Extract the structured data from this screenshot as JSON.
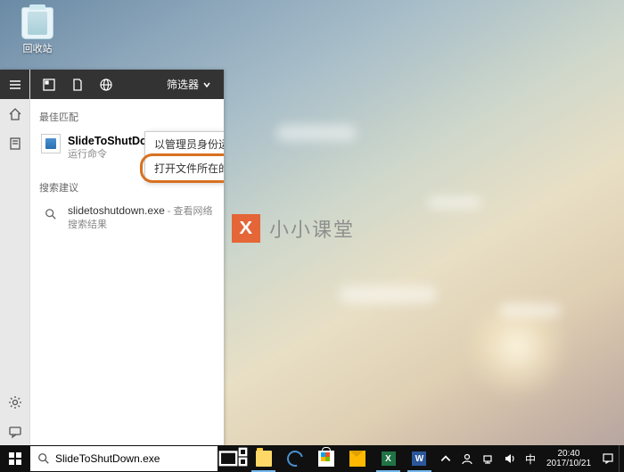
{
  "desktop": {
    "recycle_bin_label": "回收站"
  },
  "watermark": {
    "logo_text": "X",
    "text": "小小课堂"
  },
  "search_panel": {
    "filter_label": "筛选器",
    "section_best_match": "最佳匹配",
    "section_suggestions": "搜索建议",
    "best_match": {
      "title": "SlideToShutDown.exe",
      "subtitle": "运行命令"
    },
    "context_menu": {
      "run_as_admin": "以管理员身份运行",
      "open_location": "打开文件所在的位置"
    },
    "web_result": {
      "query": "slidetoshutdown.exe",
      "suffix": " - 查看网络搜索结果"
    }
  },
  "taskbar": {
    "search_value": "SlideToShutDown.exe"
  },
  "tray": {
    "time": "20:40",
    "date": "2017/10/21"
  }
}
